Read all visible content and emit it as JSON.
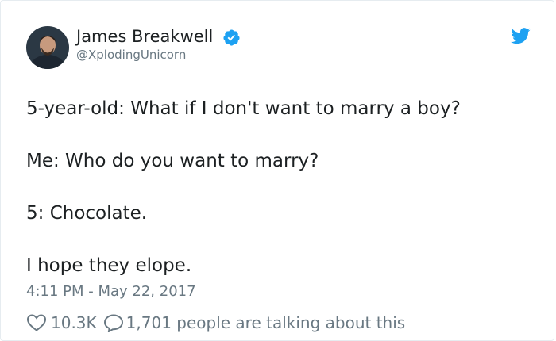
{
  "author": {
    "name": "James Breakwell",
    "handle": "@XplodingUnicorn",
    "verified": true,
    "avatar_icon": "profile-photo"
  },
  "brand": {
    "icon": "twitter-bird-icon",
    "color": "#1da1f2"
  },
  "tweet": {
    "lines": [
      "5-year-old: What if I don't want to marry a boy?",
      "Me: Who do you want to marry?",
      "5: Chocolate.",
      "I hope they elope."
    ],
    "timestamp": "4:11 PM - May 22, 2017"
  },
  "actions": {
    "likes": "10.3K",
    "talking": "1,701 people are talking about this"
  },
  "colors": {
    "text": "#1c2022",
    "secondary": "#697882",
    "verified": "#1da1f2"
  }
}
